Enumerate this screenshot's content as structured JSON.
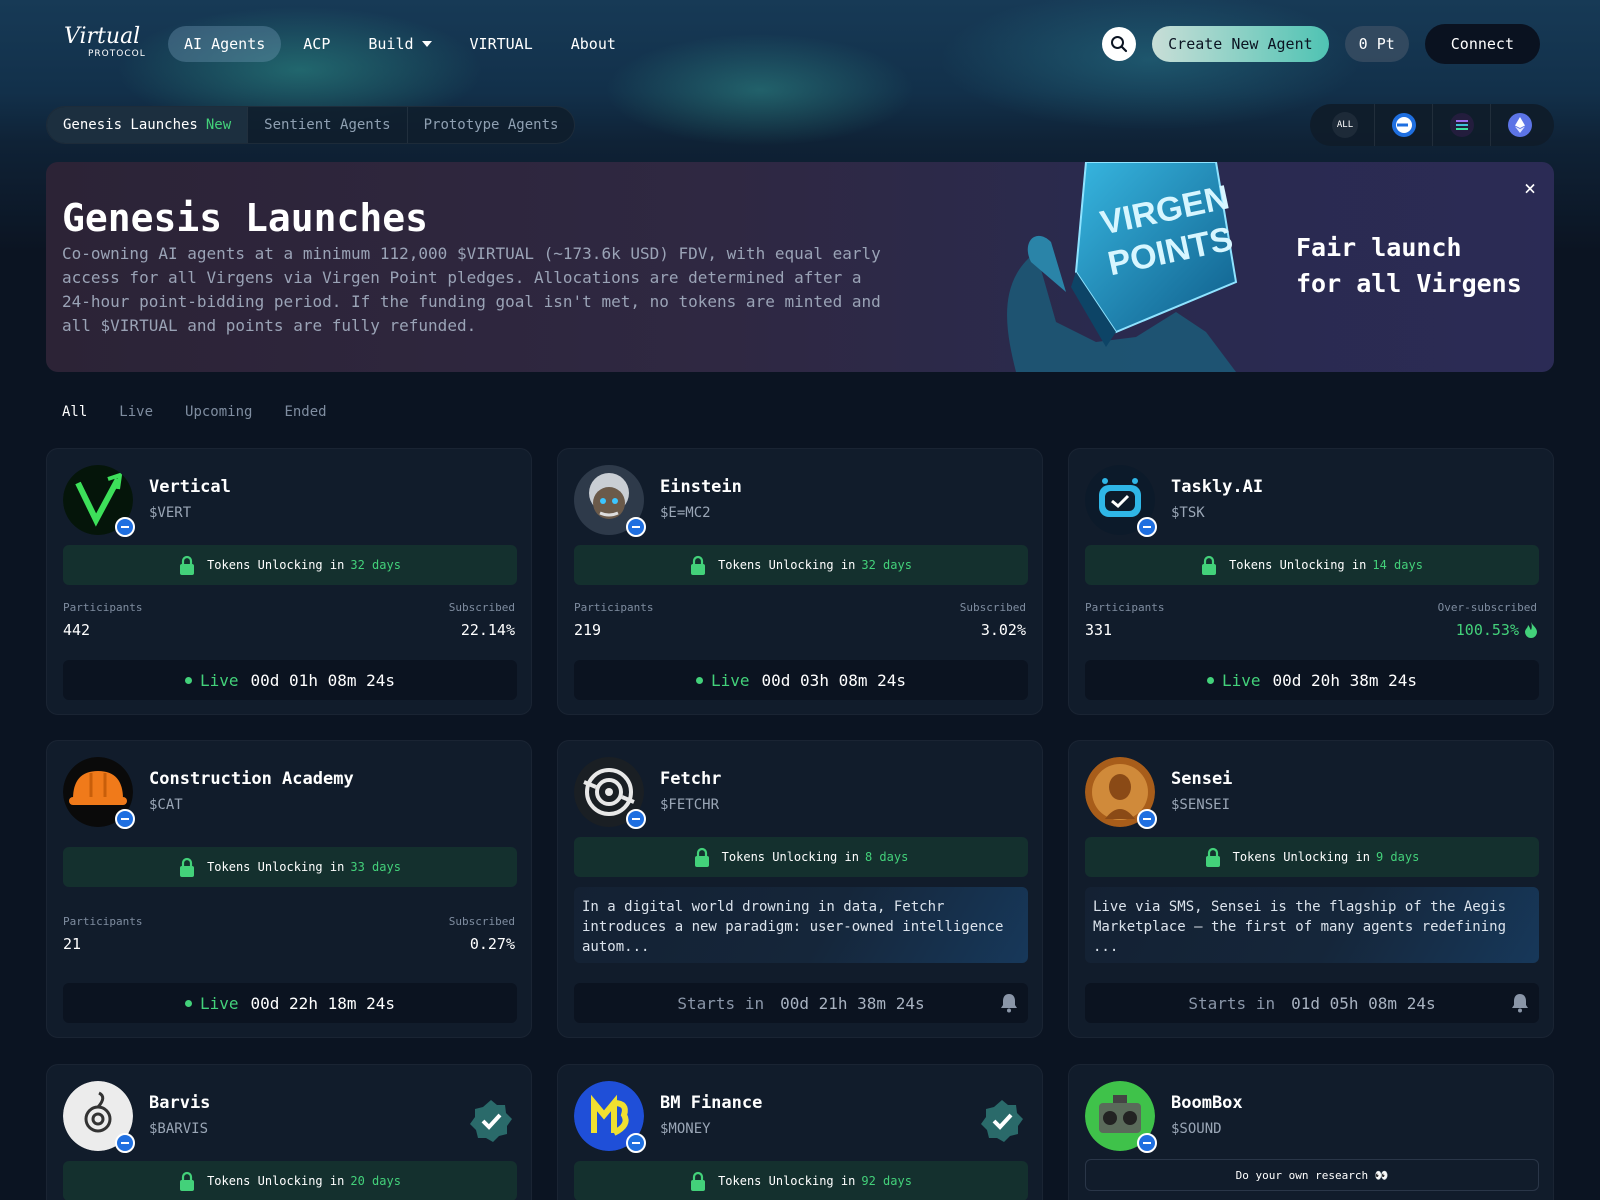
{
  "nav": {
    "logo_script": "Virtual",
    "logo_sub": "PROTOCOL",
    "links": [
      {
        "label": "AI Agents"
      },
      {
        "label": "ACP"
      },
      {
        "label": "Build"
      },
      {
        "label": "VIRTUAL"
      },
      {
        "label": "About"
      }
    ],
    "create_label": "Create New Agent",
    "points_label": "0 Pt",
    "connect_label": "Connect"
  },
  "launch_tabs": [
    {
      "label": "Genesis Launches",
      "badge": "New"
    },
    {
      "label": "Sentient Agents"
    },
    {
      "label": "Prototype Agents"
    }
  ],
  "chain_filter": {
    "all_label": "ALL"
  },
  "banner": {
    "title": "Genesis Launches",
    "description": "Co-owning AI agents at a minimum 112,000 $VIRTUAL (~173.6k USD) FDV, with equal early access for all Virgens via Virgen Point pledges. Allocations are determined after a 24-hour point-bidding period. If the funding goal isn't met, no tokens are minted and all $VIRTUAL and points are fully refunded.",
    "art_text": "VIRGEN POINTS",
    "tagline_line1": "Fair launch",
    "tagline_line2": "for all Virgens",
    "close_label": "×"
  },
  "status_tabs": [
    {
      "label": "All"
    },
    {
      "label": "Live"
    },
    {
      "label": "Upcoming"
    },
    {
      "label": "Ended"
    }
  ],
  "cards": [
    {
      "name": "Vertical",
      "ticker": "$VERT",
      "unlock_prefix": "Tokens Unlocking in",
      "unlock_days": "32 days",
      "participants_label": "Participants",
      "participants": "442",
      "subscribed_label": "Subscribed",
      "subscribed": "22.14%",
      "status": "Live",
      "countdown": "00d 01h 08m 24s"
    },
    {
      "name": "Einstein",
      "ticker": "$E=MC2",
      "unlock_prefix": "Tokens Unlocking in",
      "unlock_days": "32 days",
      "participants_label": "Participants",
      "participants": "219",
      "subscribed_label": "Subscribed",
      "subscribed": "3.02%",
      "status": "Live",
      "countdown": "00d 03h 08m 24s"
    },
    {
      "name": "Taskly.AI",
      "ticker": "$TSK",
      "unlock_prefix": "Tokens Unlocking in",
      "unlock_days": "14 days",
      "participants_label": "Participants",
      "participants": "331",
      "subscribed_label": "Over-subscribed",
      "subscribed": "100.53%",
      "status": "Live",
      "countdown": "00d 20h 38m 24s"
    },
    {
      "name": "Construction Academy",
      "ticker": "$CAT",
      "unlock_prefix": "Tokens Unlocking in",
      "unlock_days": "33 days",
      "participants_label": "Participants",
      "participants": "21",
      "subscribed_label": "Subscribed",
      "subscribed": "0.27%",
      "status": "Live",
      "countdown": "00d 22h 18m 24s"
    },
    {
      "name": "Fetchr",
      "ticker": "$FETCHR",
      "unlock_prefix": "Tokens Unlocking in",
      "unlock_days": "8 days",
      "description": "In a digital world drowning in data, Fetchr introduces a new paradigm: user-owned intelligence autom...",
      "starts_label": "Starts in",
      "countdown": "00d 21h 38m 24s"
    },
    {
      "name": "Sensei",
      "ticker": "$SENSEI",
      "unlock_prefix": "Tokens Unlocking in",
      "unlock_days": "9 days",
      "description": "Live via SMS, Sensei is the flagship of the Aegis Marketplace – the first of many agents redefining ...",
      "starts_label": "Starts in",
      "countdown": "01d 05h 08m 24s"
    },
    {
      "name": "Barvis",
      "ticker": "$BARVIS",
      "unlock_prefix": "Tokens Unlocking in",
      "unlock_days": "20 days"
    },
    {
      "name": "BM Finance",
      "ticker": "$MONEY",
      "unlock_prefix": "Tokens Unlocking in",
      "unlock_days": "92 days"
    },
    {
      "name": "BoomBox",
      "ticker": "$SOUND",
      "dyor": "Do your own research 👀"
    }
  ],
  "colors": {
    "accent_green": "#43d17a",
    "background": "#0b1422",
    "card": "#111c2b",
    "chain_blue": "#1f6fe0"
  }
}
